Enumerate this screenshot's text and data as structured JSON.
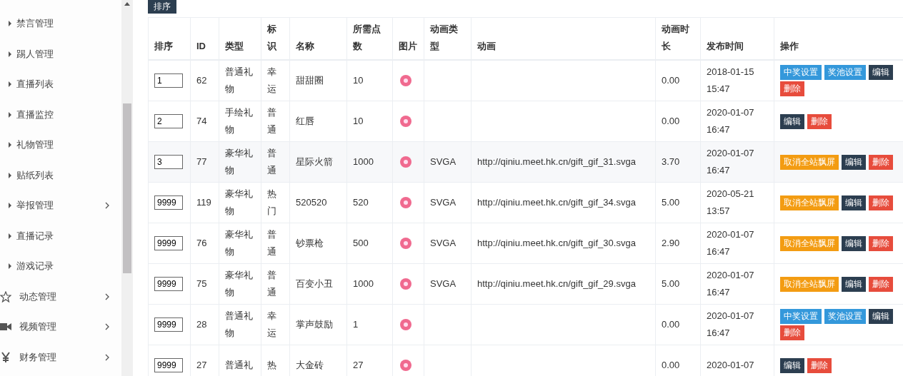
{
  "sidebar": {
    "items": [
      {
        "label": "禁言管理",
        "kind": "sub",
        "has_children": false
      },
      {
        "label": "踢人管理",
        "kind": "sub",
        "has_children": false
      },
      {
        "label": "直播列表",
        "kind": "sub",
        "has_children": false
      },
      {
        "label": "直播监控",
        "kind": "sub",
        "has_children": false
      },
      {
        "label": "礼物管理",
        "kind": "sub",
        "has_children": false
      },
      {
        "label": "贴纸列表",
        "kind": "sub",
        "has_children": false
      },
      {
        "label": "举报管理",
        "kind": "sub",
        "has_children": true
      },
      {
        "label": "直播记录",
        "kind": "sub",
        "has_children": false
      },
      {
        "label": "游戏记录",
        "kind": "sub",
        "has_children": false
      },
      {
        "label": "动态管理",
        "kind": "star",
        "has_children": true
      },
      {
        "label": "视频管理",
        "kind": "video",
        "has_children": true
      },
      {
        "label": "财务管理",
        "kind": "yen",
        "has_children": true
      }
    ]
  },
  "sort_button": "排序",
  "table": {
    "columns": [
      "排序",
      "ID",
      "类型",
      "标识",
      "名称",
      "所需点数",
      "图片",
      "动画类型",
      "动画",
      "动画时长",
      "发布时间",
      "操作"
    ],
    "rows": [
      {
        "sort": "1",
        "id": "62",
        "type": "普通礼物",
        "tag": "幸运",
        "name": "甜甜圈",
        "points": "10",
        "anim_type": "",
        "anim": "",
        "duration": "0.00",
        "time": "2018-01-15 15:47",
        "actions": [
          {
            "label": "中奖设置",
            "kind": "info"
          },
          {
            "label": "奖池设置",
            "kind": "info"
          },
          {
            "label": "编辑",
            "kind": "dark"
          },
          {
            "label": "删除",
            "kind": "danger"
          }
        ]
      },
      {
        "sort": "2",
        "id": "74",
        "type": "手绘礼物",
        "tag": "普通",
        "name": "红唇",
        "points": "10",
        "anim_type": "",
        "anim": "",
        "duration": "0.00",
        "time": "2020-01-07 16:47",
        "actions": [
          {
            "label": "编辑",
            "kind": "dark"
          },
          {
            "label": "删除",
            "kind": "danger"
          }
        ]
      },
      {
        "sort": "3",
        "id": "77",
        "type": "豪华礼物",
        "tag": "普通",
        "name": "星际火箭",
        "points": "1000",
        "anim_type": "SVGA",
        "anim": "http://qiniu.meet.hk.cn/gift_gif_31.svga",
        "duration": "3.70",
        "time": "2020-01-07 16:47",
        "actions": [
          {
            "label": "取消全站飘屏",
            "kind": "warning"
          },
          {
            "label": "编辑",
            "kind": "dark"
          },
          {
            "label": "删除",
            "kind": "danger"
          }
        ]
      },
      {
        "sort": "9999",
        "id": "119",
        "type": "豪华礼物",
        "tag": "热门",
        "name": "520520",
        "points": "520",
        "anim_type": "SVGA",
        "anim": "http://qiniu.meet.hk.cn/gift_gif_34.svga",
        "duration": "5.00",
        "time": "2020-05-21 13:57",
        "actions": [
          {
            "label": "取消全站飘屏",
            "kind": "warning"
          },
          {
            "label": "编辑",
            "kind": "dark"
          },
          {
            "label": "删除",
            "kind": "danger"
          }
        ]
      },
      {
        "sort": "9999",
        "id": "76",
        "type": "豪华礼物",
        "tag": "普通",
        "name": "钞票枪",
        "points": "500",
        "anim_type": "SVGA",
        "anim": "http://qiniu.meet.hk.cn/gift_gif_30.svga",
        "duration": "2.90",
        "time": "2020-01-07 16:47",
        "actions": [
          {
            "label": "取消全站飘屏",
            "kind": "warning"
          },
          {
            "label": "编辑",
            "kind": "dark"
          },
          {
            "label": "删除",
            "kind": "danger"
          }
        ]
      },
      {
        "sort": "9999",
        "id": "75",
        "type": "豪华礼物",
        "tag": "普通",
        "name": "百变小丑",
        "points": "1000",
        "anim_type": "SVGA",
        "anim": "http://qiniu.meet.hk.cn/gift_gif_29.svga",
        "duration": "5.00",
        "time": "2020-01-07 16:47",
        "actions": [
          {
            "label": "取消全站飘屏",
            "kind": "warning"
          },
          {
            "label": "编辑",
            "kind": "dark"
          },
          {
            "label": "删除",
            "kind": "danger"
          }
        ]
      },
      {
        "sort": "9999",
        "id": "28",
        "type": "普通礼物",
        "tag": "幸运",
        "name": "掌声鼓励",
        "points": "1",
        "anim_type": "",
        "anim": "",
        "duration": "0.00",
        "time": "2020-01-07 16:47",
        "actions": [
          {
            "label": "中奖设置",
            "kind": "info"
          },
          {
            "label": "奖池设置",
            "kind": "info"
          },
          {
            "label": "编辑",
            "kind": "dark"
          },
          {
            "label": "删除",
            "kind": "danger"
          }
        ]
      },
      {
        "sort": "9999",
        "id": "27",
        "type": "普通礼",
        "tag": "热",
        "name": "大金砖",
        "points": "27",
        "anim_type": "",
        "anim": "",
        "duration": "0.00",
        "time": "2020-01-07",
        "actions": [
          {
            "label": "编辑",
            "kind": "dark"
          },
          {
            "label": "删除",
            "kind": "danger"
          }
        ]
      }
    ]
  }
}
